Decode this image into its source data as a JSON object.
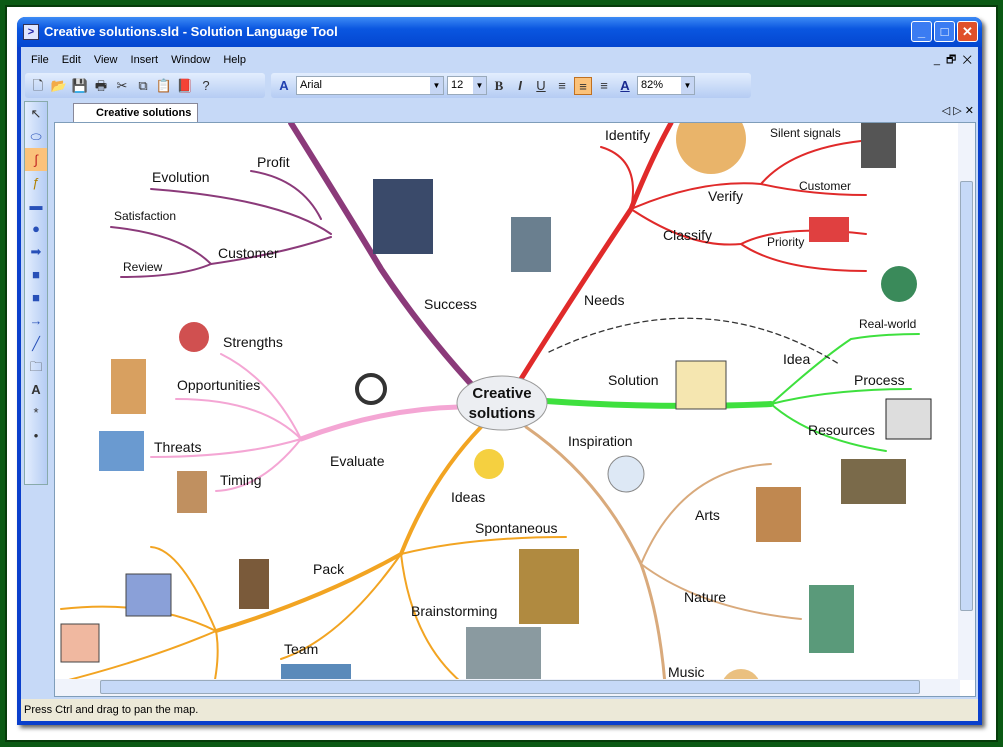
{
  "window": {
    "title": "Creative solutions.sld - Solution Language Tool",
    "minimize": "_",
    "maximize": "□",
    "close": "✕"
  },
  "menu": [
    "File",
    "Edit",
    "View",
    "Insert",
    "Window",
    "Help"
  ],
  "toolbar": {
    "font": "Arial",
    "size": "12",
    "zoom": "82%",
    "bold": "B",
    "italic": "I",
    "underline": "U",
    "align_center_active": true
  },
  "tab": {
    "label": "Creative solutions"
  },
  "status": "Press Ctrl and drag to pan the map.",
  "colors": {
    "success": "#8b3a7a",
    "needs": "#e02a2a",
    "solution": "#3ee03e",
    "evaluate": "#f4a6d4",
    "ideas": "#f2a422",
    "inspiration": "#d9aa7c"
  },
  "map": {
    "center": [
      "Creative",
      "solutions"
    ],
    "success": {
      "label": "Success",
      "items": [
        "Profit",
        "Evolution",
        "Customer",
        "Satisfaction",
        "Review"
      ]
    },
    "needs": {
      "label": "Needs",
      "items": [
        "Identify",
        "Verify",
        "Silent signals",
        "Customer",
        "Classify",
        "Priority"
      ]
    },
    "solution": {
      "label": "Solution",
      "items": [
        "Idea",
        "Real-world",
        "Process",
        "Resources"
      ]
    },
    "evaluate": {
      "label": "Evaluate",
      "items": [
        "Strengths",
        "Opportunities",
        "Threats",
        "Timing"
      ]
    },
    "ideas": {
      "label": "Ideas",
      "items": [
        "Spontaneous",
        "Pack",
        "Team",
        "Brainstorming"
      ]
    },
    "inspiration": {
      "label": "Inspiration",
      "items": [
        "Arts",
        "Nature",
        "Music"
      ]
    }
  }
}
